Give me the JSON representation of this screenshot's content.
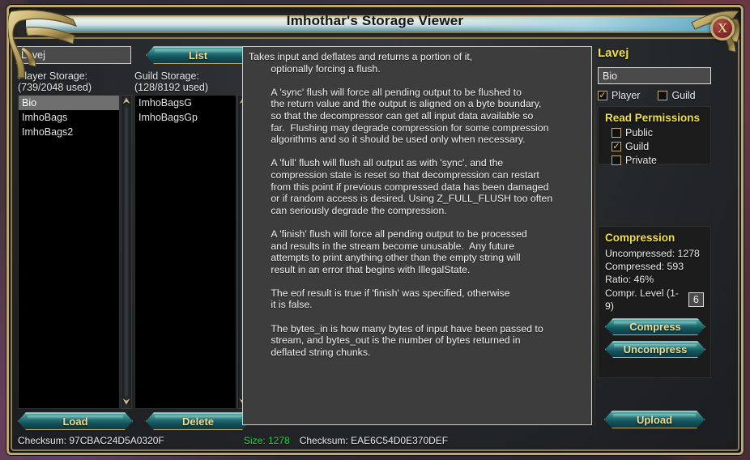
{
  "window": {
    "title": "Imhothar's Storage Viewer",
    "close_label": "X"
  },
  "left": {
    "name_value": "Lavej",
    "list_button": "List",
    "player_storage_label": "Player Storage:\n(739/2048 used)",
    "guild_storage_label": "Guild Storage:\n(128/8192 used)",
    "player_items": [
      {
        "label": "Bio",
        "selected": true
      },
      {
        "label": "ImhoBags",
        "selected": false
      },
      {
        "label": "ImhoBags2",
        "selected": false
      }
    ],
    "guild_items": [
      {
        "label": "ImhoBagsG",
        "selected": false
      },
      {
        "label": "ImhoBagsGp",
        "selected": false
      }
    ],
    "load_button": "Load",
    "delete_button": "Delete",
    "checksum": "Checksum: 97CBAC24D5A0320F"
  },
  "center": {
    "body_text": "Takes input and deflates and returns a portion of it,\n        optionally forcing a flush.\n\n        A 'sync' flush will force all pending output to be flushed to\n        the return value and the output is aligned on a byte boundary,\n        so that the decompressor can get all input data available so\n        far.  Flushing may degrade compression for some compression\n        algorithms and so it should be used only when necessary.\n\n        A 'full' flush will flush all output as with 'sync', and the\n        compression state is reset so that decompression can restart\n        from this point if previous compressed data has been damaged\n        or if random access is desired. Using Z_FULL_FLUSH too often\n        can seriously degrade the compression.\n\n        A 'finish' flush will force all pending output to be processed\n        and results in the stream become unusable.  Any future\n        attempts to print anything other than the empty string will\n        result in an error that begins with IllegalState.\n\n        The eof result is true if 'finish' was specified, otherwise\n        it is false.\n\n        The bytes_in is how many bytes of input have been passed to\n        stream, and bytes_out is the number of bytes returned in\n        deflated string chunks.",
    "size_text": "Size: 1278",
    "checksum_text": "Checksum: EAE6C54D0E370DEF"
  },
  "right": {
    "player_name": "Lavej",
    "bio_value": "Bio",
    "scope": [
      {
        "label": "Player",
        "checked": true
      },
      {
        "label": "Guild",
        "checked": false
      }
    ],
    "permissions_title": "Read Permissions",
    "permissions": [
      {
        "label": "Public",
        "checked": false
      },
      {
        "label": "Guild",
        "checked": true
      },
      {
        "label": "Private",
        "checked": false
      }
    ],
    "compression_title": "Compression",
    "uncompressed": "Uncompressed: 1278",
    "compressed": "Compressed: 593",
    "ratio": "Ratio: 46%",
    "level_label": "Compr. Level (1-9)",
    "level_value": "6",
    "compress_button": "Compress",
    "uncompress_button": "Uncompress",
    "upload_button": "Upload"
  },
  "icons": {
    "scroll_up": "⮝",
    "scroll_down": "⮟",
    "check": "✓"
  },
  "colors": {
    "accent_gold": "#f2e03c",
    "frame_gold": "#bda96f",
    "button_teal": "#2e7f82",
    "size_green": "#28d64a",
    "close_red": "#8e2f2c"
  }
}
